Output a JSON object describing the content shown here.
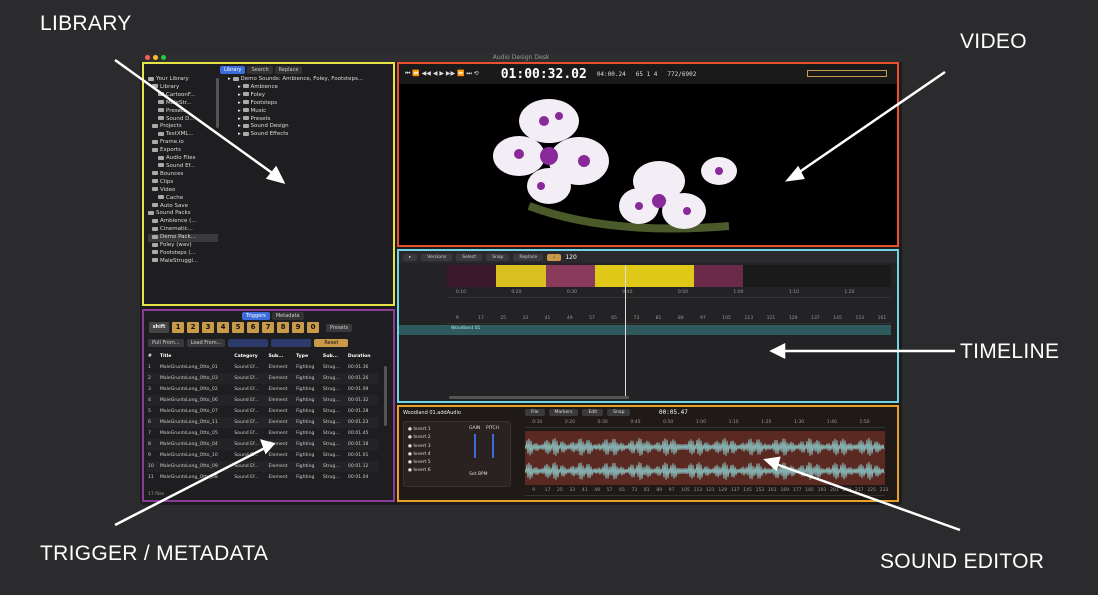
{
  "labels": {
    "library": "LIBRARY",
    "video": "VIDEO",
    "timeline": "TIMELINE",
    "trigger": "TRIGGER / METADATA",
    "sound_editor": "SOUND EDITOR"
  },
  "window": {
    "title": "Audio Design Desk"
  },
  "library": {
    "tabs": [
      "Library",
      "Search",
      "Replace"
    ],
    "left_tree": [
      "Your Library",
      "Library",
      "CartoonF...",
      "MaleStr...",
      "Presets",
      "Sound D...",
      "Projects",
      "TestXML...",
      "Frame.io",
      "Exports",
      "Audio Files",
      "Sound Ef...",
      "Bounces",
      "Clips",
      "Video",
      "Cache",
      "Auto Save",
      "Sound Packs",
      "Ambience (...",
      "Cinematic...",
      "Demo Pack...",
      "Foley (wav)",
      "Footsteps (...",
      "MaleStruggl..."
    ],
    "right_tree": [
      "Demo Sounds: Ambience, Foley, Footsteps...",
      "Ambience",
      "Foley",
      "Footsteps",
      "Music",
      "Presets",
      "Sound Design",
      "Sound Effects"
    ]
  },
  "triggers": {
    "tabs": [
      "Triggers",
      "Metadata"
    ],
    "shift": "shift",
    "keys": [
      "1",
      "2",
      "3",
      "4",
      "5",
      "6",
      "7",
      "8",
      "9",
      "0"
    ],
    "presets": "Presets",
    "pull_from": "Pull From...",
    "load_from": "Load From...",
    "reset": "Reset",
    "columns": [
      "#",
      "Title",
      "Category",
      "Sub...",
      "Type",
      "Sub...",
      "Duration"
    ],
    "rows": [
      [
        "1",
        "MaleGruntsLong_Otto_01",
        "Sound Ef...",
        "Element",
        "Fighting",
        "Strug...",
        "00:01.36"
      ],
      [
        "2",
        "MaleGruntsLong_Otto_03",
        "Sound Ef...",
        "Element",
        "Fighting",
        "Strug...",
        "00:01.26"
      ],
      [
        "3",
        "MaleGruntsLong_Otto_02",
        "Sound Ef...",
        "Element",
        "Fighting",
        "Strug...",
        "00:01.09"
      ],
      [
        "4",
        "MaleGruntsLong_Otto_06",
        "Sound Ef...",
        "Element",
        "Fighting",
        "Strug...",
        "00:01.32"
      ],
      [
        "5",
        "MaleGruntsLong_Otto_07",
        "Sound Ef...",
        "Element",
        "Fighting",
        "Strug...",
        "00:01.28"
      ],
      [
        "6",
        "MaleGruntsLong_Otto_11",
        "Sound Ef...",
        "Element",
        "Fighting",
        "Strug...",
        "00:01.23"
      ],
      [
        "7",
        "MaleGruntsLong_Otto_05",
        "Sound Ef...",
        "Element",
        "Fighting",
        "Strug...",
        "00:01.45"
      ],
      [
        "8",
        "MaleGruntsLong_Otto_04",
        "Sound Ef...",
        "Element",
        "Fighting",
        "Strug...",
        "00:01.18"
      ],
      [
        "9",
        "MaleGruntsLong_Otto_10",
        "Sound Ef...",
        "Element",
        "Fighting",
        "Strug...",
        "00:01.01"
      ],
      [
        "10",
        "MaleGruntsLong_Otto_09",
        "Sound Ef...",
        "Element",
        "Fighting",
        "Strug...",
        "00:01.12"
      ],
      [
        "11",
        "MaleGruntsLong_Otto_08",
        "Sound Ef...",
        "Element",
        "Fighting",
        "Strug...",
        "00:01.04"
      ]
    ],
    "footer": "17 files"
  },
  "video": {
    "timecode": "01:00:32.02",
    "tc2": "04:00.24",
    "tc3": "65 1 4",
    "tc4": "772/6902"
  },
  "timeline": {
    "versions": "Versions",
    "select": "Select",
    "snap": "Snap",
    "replace": "Replace",
    "bpm": "120",
    "ruler": [
      "0:10",
      "0:20",
      "0:30",
      "0:40",
      "0:50",
      "1:00",
      "1:10",
      "1:20"
    ],
    "bars": [
      "9",
      "17",
      "25",
      "33",
      "41",
      "49",
      "57",
      "65",
      "73",
      "81",
      "89",
      "97",
      "105",
      "113",
      "121",
      "129",
      "137",
      "145",
      "153",
      "161"
    ],
    "track_label": "Woodland 01"
  },
  "editor": {
    "title": "Woodland 01.addAudio",
    "menus": [
      "File",
      "Markers",
      "Edit",
      "Snap"
    ],
    "time": "00:05.47",
    "inserts": [
      "Insert 1",
      "Insert 2",
      "Insert 3",
      "Insert 4",
      "Insert 5",
      "Insert 6"
    ],
    "gain": "GAIN",
    "pitch": "PITCH",
    "set_bpm": "Set BPM",
    "ruler": [
      "0:10",
      "0:20",
      "0:30",
      "0:40",
      "0:50",
      "1:00",
      "1:10",
      "1:20",
      "1:30",
      "1:40",
      "1:50"
    ],
    "bars": [
      "9",
      "17",
      "25",
      "33",
      "41",
      "49",
      "57",
      "65",
      "73",
      "81",
      "89",
      "97",
      "105",
      "113",
      "121",
      "129",
      "137",
      "145",
      "153",
      "161",
      "169",
      "177",
      "185",
      "193",
      "201",
      "209",
      "217",
      "225",
      "233"
    ]
  },
  "colors": {
    "library": "#e7e247",
    "video": "#e8502e",
    "timeline": "#6fd4e4",
    "trigger": "#8c3b96",
    "editor": "#e8a028"
  }
}
